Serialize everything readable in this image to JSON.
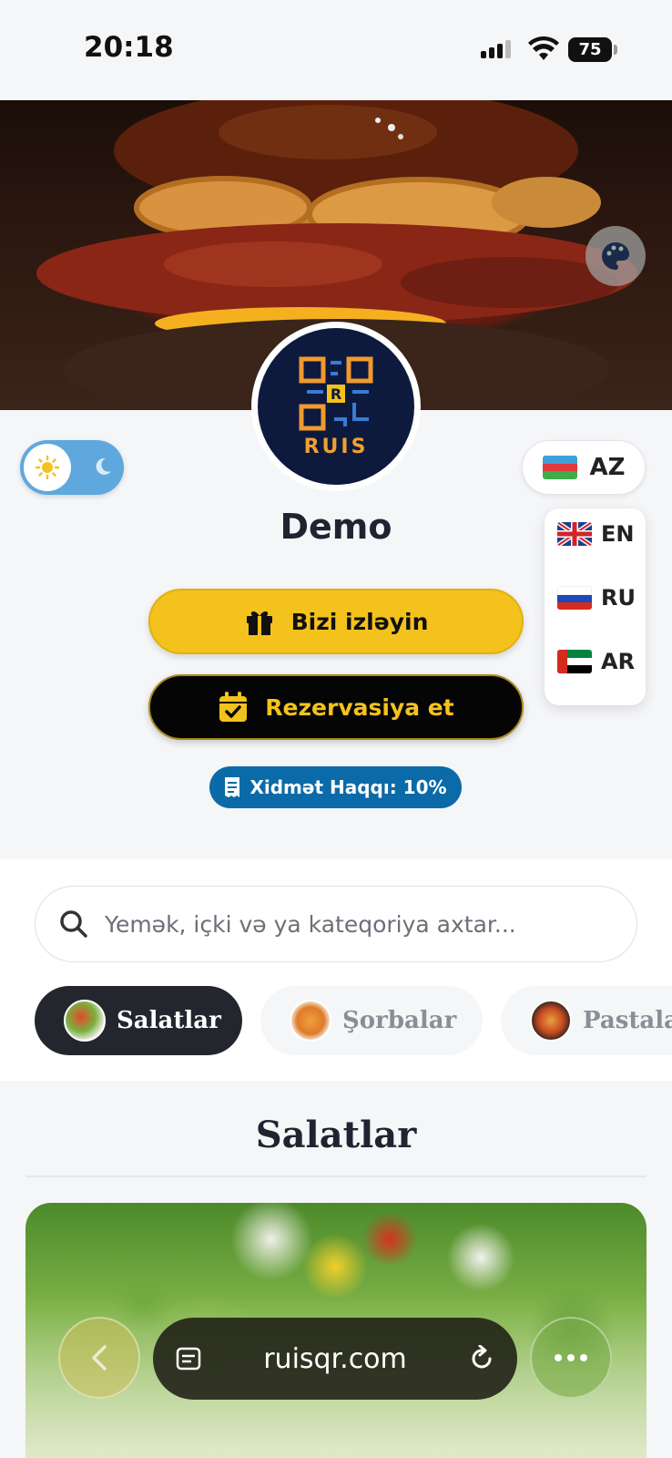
{
  "status_bar": {
    "time": "20:18",
    "battery": "75"
  },
  "logo": {
    "text": "RUIS"
  },
  "restaurant": {
    "name": "Demo"
  },
  "language": {
    "current": "AZ",
    "options": [
      {
        "code": "EN"
      },
      {
        "code": "RU"
      },
      {
        "code": "AR"
      }
    ]
  },
  "actions": {
    "follow_label": "Bizi izləyin",
    "reserve_label": "Rezervasiya et",
    "service_fee": "Xidmət Haqqı: 10%"
  },
  "search": {
    "placeholder": "Yemək, içki və ya kateqoriya axtar..."
  },
  "tabs": [
    {
      "label": "Salatlar",
      "active": true
    },
    {
      "label": "Şorbalar",
      "active": false
    },
    {
      "label": "Pastalar",
      "active": false
    }
  ],
  "section": {
    "title": "Salatlar"
  },
  "browser": {
    "url": "ruisqr.com"
  },
  "colors": {
    "accent_yellow": "#f4c21c",
    "badge_blue": "#0b6aa8",
    "dark": "#23262d"
  }
}
